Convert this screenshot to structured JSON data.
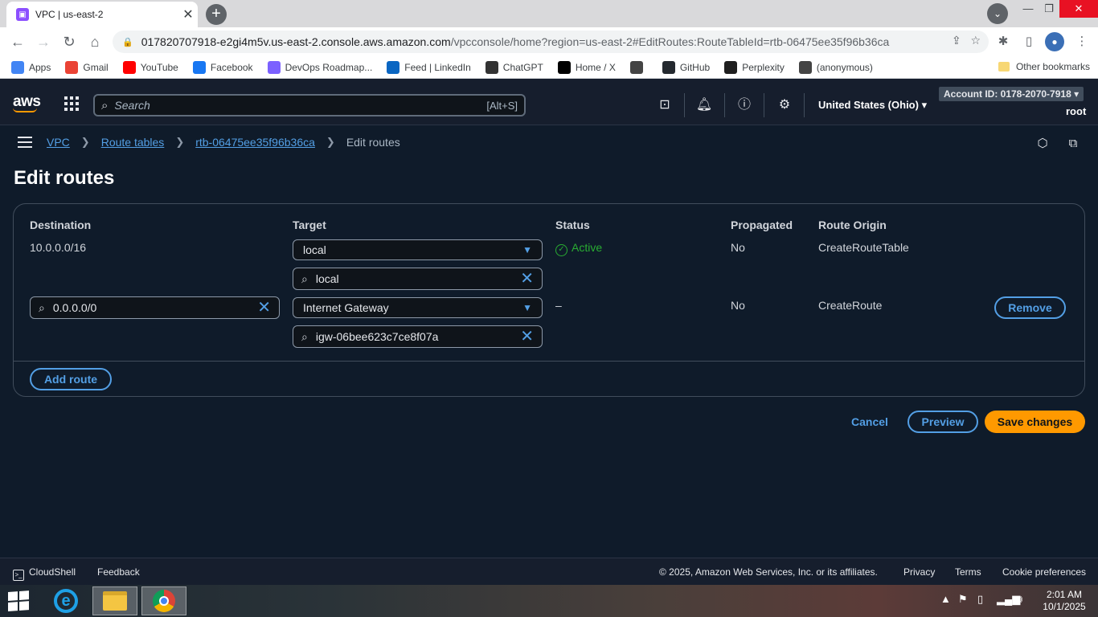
{
  "browser": {
    "tab_title": "VPC | us-east-2",
    "tab_favicon": "aws-vpc-icon",
    "url_host": "017820707918-e2gi4m5v.us-east-2.console.aws.amazon.com",
    "url_path": "/vpcconsole/home?region=us-east-2#EditRoutes:RouteTableId=rtb-06475ee35f96b36ca",
    "bookmarks": [
      {
        "label": "Apps",
        "icon": "apps-grid-icon",
        "color": "#4285f4"
      },
      {
        "label": "Gmail",
        "icon": "gmail-icon",
        "color": "#ea4335"
      },
      {
        "label": "YouTube",
        "icon": "youtube-icon",
        "color": "#ff0000"
      },
      {
        "label": "Facebook",
        "icon": "facebook-icon",
        "color": "#1877f2"
      },
      {
        "label": "DevOps Roadmap...",
        "icon": "roadmap-icon",
        "color": "#7b61ff"
      },
      {
        "label": "Feed | LinkedIn",
        "icon": "linkedin-icon",
        "color": "#0a66c2"
      },
      {
        "label": "ChatGPT",
        "icon": "chatgpt-icon",
        "color": "#333333"
      },
      {
        "label": "Home / X",
        "icon": "x-icon",
        "color": "#000000"
      },
      {
        "label": "",
        "icon": "globe-icon",
        "color": "#444444"
      },
      {
        "label": "GitHub",
        "icon": "github-icon",
        "color": "#24292f"
      },
      {
        "label": "Perplexity",
        "icon": "perplexity-icon",
        "color": "#1f1f1f"
      },
      {
        "label": "(anonymous)",
        "icon": "globe-icon",
        "color": "#444444"
      }
    ],
    "other_bookmarks": "Other bookmarks"
  },
  "aws_header": {
    "logo": "aws",
    "search_placeholder": "Search",
    "search_shortcut": "[Alt+S]",
    "region": "United States (Ohio)",
    "account": "Account ID: 0178-2070-7918",
    "user": "root"
  },
  "breadcrumbs": {
    "items": [
      "VPC",
      "Route tables",
      "rtb-06475ee35f96b36ca"
    ],
    "current": "Edit routes"
  },
  "page": {
    "title": "Edit routes",
    "columns": [
      "Destination",
      "Target",
      "Status",
      "Propagated",
      "Route Origin"
    ],
    "routes": [
      {
        "destination": "10.0.0.0/16",
        "target_type": "local",
        "target_value": "local",
        "status": "Active",
        "propagated": "No",
        "origin": "CreateRouteTable"
      },
      {
        "destination": "0.0.0.0/0",
        "target_type": "Internet Gateway",
        "target_value": "igw-06bee623c7ce8f07a",
        "status": "–",
        "propagated": "No",
        "origin": "CreateRoute",
        "remove_label": "Remove"
      }
    ],
    "add_route_label": "Add route",
    "cancel_label": "Cancel",
    "preview_label": "Preview",
    "save_label": "Save changes"
  },
  "footer": {
    "cloudshell": "CloudShell",
    "feedback": "Feedback",
    "copyright": "© 2025, Amazon Web Services, Inc. or its affiliates.",
    "links": [
      "Privacy",
      "Terms",
      "Cookie preferences"
    ]
  },
  "taskbar": {
    "time": "2:01 AM",
    "date": "10/1/2025"
  },
  "colors": {
    "accent_orange": "#ff9900",
    "link_blue": "#539fe5",
    "active_green": "#29ad32",
    "background": "#0f1b2a"
  }
}
